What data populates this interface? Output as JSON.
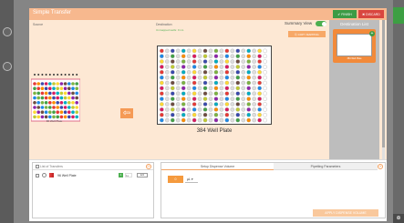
{
  "app": {
    "title": "Simple Transfer",
    "finish_label": "FINISH",
    "discard_label": "DISCARD"
  },
  "source": {
    "label": "Source",
    "plate_label": "96 Well Plate"
  },
  "destination": {
    "label": "Destination",
    "subtitle": "Unmapped wells: 0 mL",
    "plate_label": "384 Well Plate"
  },
  "summary": {
    "label": "Summary View"
  },
  "copy_mapping": {
    "label": "COPY MAPPING"
  },
  "dest_list": {
    "title": "Destination List",
    "item_label": "384 Well Plate"
  },
  "transfers": {
    "title": "List of Transfers",
    "row": {
      "label": "96 Well Plate",
      "badge": "1",
      "select": "1x",
      "button": "Edit"
    }
  },
  "dispense": {
    "tab1": "Setup Dispense Volume",
    "tab2": "Pipetting Parameters",
    "volume": "0",
    "unit": "µL",
    "apply_label": "APPLY DISPENSE VOLUME"
  },
  "colors": {
    "accent": "#f59a55",
    "header": "#f7b88e",
    "green": "#3c9b45",
    "red": "#d9463f"
  }
}
